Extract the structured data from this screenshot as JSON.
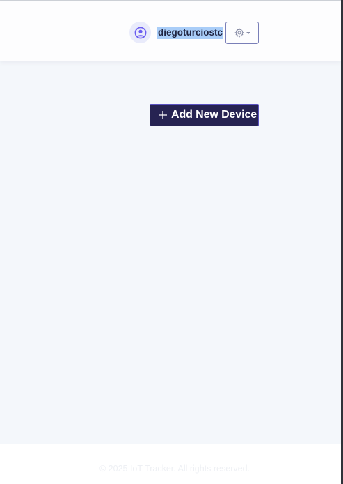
{
  "header": {
    "username": "diegoturciostc",
    "icons": {
      "avatar": "user-circle-icon",
      "settings": "gear-icon",
      "settings_caret": "caret-down-icon"
    }
  },
  "main": {
    "add_device_label": "Add New Device",
    "add_device_icon": "plus-icon"
  },
  "footer": {
    "copyright": "© 2025 IoT Tracker. All rights reserved."
  },
  "colors": {
    "accent": "#262352",
    "avatar_icon": "#6a5cf0",
    "selection_highlight": "#a9cdf8",
    "page_background": "#f4f7fb"
  }
}
